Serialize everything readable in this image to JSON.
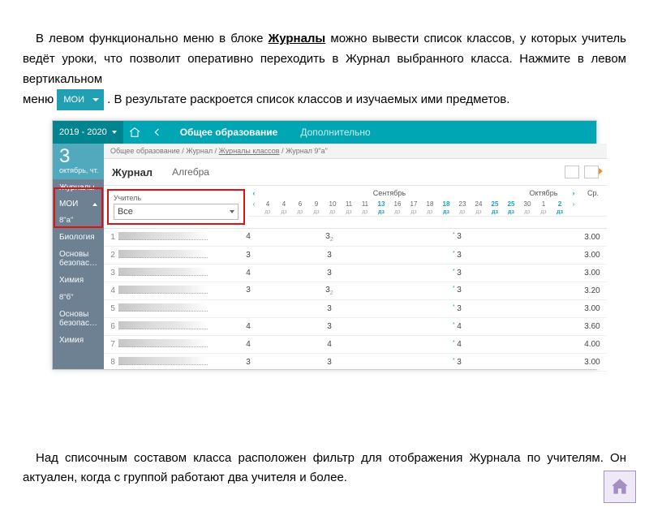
{
  "para1": {
    "pre": "В левом функционально меню в блоке",
    "bold": "Журналы",
    "post": "можно вывести список классов, у которых учитель ведёт уроки, что позволит оперативно переходить в Журнал выбранного класса. Нажмите  в левом вертикальном"
  },
  "para1b": {
    "pre": "меню ",
    "badge": "МОИ",
    "post": ". В результате раскроется список классов и изучаемых ими предметов."
  },
  "para2": "Над списочным составом класса расположен фильтр для отображения Журнала по учителям. Он актуален, когда с группой работают два учителя и более.",
  "app": {
    "year": "2019 - 2020",
    "tab1": "Общее образование",
    "tab2": "Дополнительно",
    "date_num": "3",
    "date_name": "октябрь, чт.",
    "sb_cat": "Журналы",
    "sb_moi": "МОИ",
    "sb_items": [
      "8\"а\"",
      "Биология",
      "Основы безопас…",
      "Химия",
      "8\"б\"",
      "Основы безопас…",
      "Химия"
    ],
    "crumb": {
      "p1": "Общее образование / Журнал / ",
      "u": "Журналы классов",
      "p2": " / Журнал 9\"а\""
    },
    "journal_title": "Журнал",
    "subject": "Алгебра",
    "teacher_lbl": "Учитель",
    "teacher_val": "Все",
    "month1": "Сентябрь",
    "month2": "Октябрь",
    "sr": "Ср.",
    "days": [
      "4",
      "4",
      "6",
      "9",
      "10",
      "11",
      "11",
      "13",
      "16",
      "17",
      "18",
      "18",
      "23",
      "24",
      "25",
      "25",
      "30",
      "1",
      "2"
    ],
    "days_teal": [
      7,
      11,
      14,
      15,
      18
    ],
    "rows": [
      {
        "idx": 1,
        "marks": {
          "0": "4",
          "5": {
            "v": "3",
            "s": "2"
          },
          "13": {
            "v": "3",
            "st": true
          }
        },
        "avg": "3.00"
      },
      {
        "idx": 2,
        "marks": {
          "0": "3",
          "5": "3",
          "13": {
            "v": "3",
            "st": true
          }
        },
        "avg": "3.00"
      },
      {
        "idx": 3,
        "marks": {
          "0": "4",
          "5": "3",
          "13": {
            "v": "3",
            "st": true
          }
        },
        "avg": "3.00"
      },
      {
        "idx": 4,
        "marks": {
          "0": "3",
          "5": {
            "v": "3",
            "s": "2"
          },
          "13": {
            "v": "3",
            "st": true
          }
        },
        "avg": "3.20"
      },
      {
        "idx": 5,
        "marks": {
          "5": "3",
          "13": {
            "v": "3",
            "st": true
          }
        },
        "avg": "3.00"
      },
      {
        "idx": 6,
        "marks": {
          "0": "4",
          "5": "3",
          "13": {
            "v": "4",
            "st": true
          }
        },
        "avg": "3.60"
      },
      {
        "idx": 7,
        "marks": {
          "0": "4",
          "5": "4",
          "13": {
            "v": "4",
            "st": true
          }
        },
        "avg": "4.00"
      },
      {
        "idx": 8,
        "marks": {
          "0": "3",
          "5": "3",
          "13": {
            "v": "3",
            "st": true
          }
        },
        "avg": "3.00"
      }
    ]
  }
}
